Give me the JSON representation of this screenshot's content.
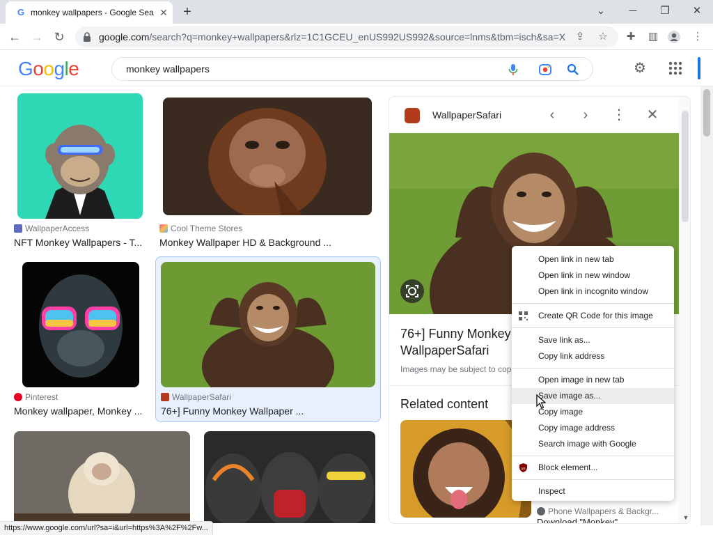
{
  "browser": {
    "tab_title": "monkey wallpapers - Google Sea",
    "url_host": "google.com",
    "url_path": "/search?q=monkey+wallpapers&rlz=1C1GCEU_enUS992US992&source=lnms&tbm=isch&sa=X..."
  },
  "google": {
    "logo": "Google",
    "query": "monkey wallpapers"
  },
  "results": [
    {
      "source": "WallpaperAccess",
      "title": "NFT Monkey Wallpapers - T..."
    },
    {
      "source": "Cool Theme Stores",
      "title": "Monkey Wallpaper HD & Background ..."
    },
    {
      "source": "Pinterest",
      "title": "Monkey wallpaper, Monkey ..."
    },
    {
      "source": "WallpaperSafari",
      "title": "76+] Funny Monkey Wallpaper ..."
    }
  ],
  "panel": {
    "source": "WallpaperSafari",
    "title_line1": "76+] Funny Monkey",
    "title_line2": "WallpaperSafari",
    "note": "Images may be subject to cop",
    "related_heading": "Related content",
    "related_source": "Phone Wallpapers & Backgr...",
    "related_title": "Download \"Monkey\""
  },
  "context_menu": {
    "items": [
      "Open link in new tab",
      "Open link in new window",
      "Open link in incognito window",
      "Create QR Code for this image",
      "Save link as...",
      "Copy link address",
      "Open image in new tab",
      "Save image as...",
      "Copy image",
      "Copy image address",
      "Search image with Google",
      "Block element...",
      "Inspect"
    ]
  },
  "status_url": "https://www.google.com/url?sa=i&url=https%3A%2F%2Fw...",
  "colors": {
    "accent": "#1a73e8",
    "selected_card_bg": "#e8f0fe",
    "menu_hover": "#ececec"
  }
}
